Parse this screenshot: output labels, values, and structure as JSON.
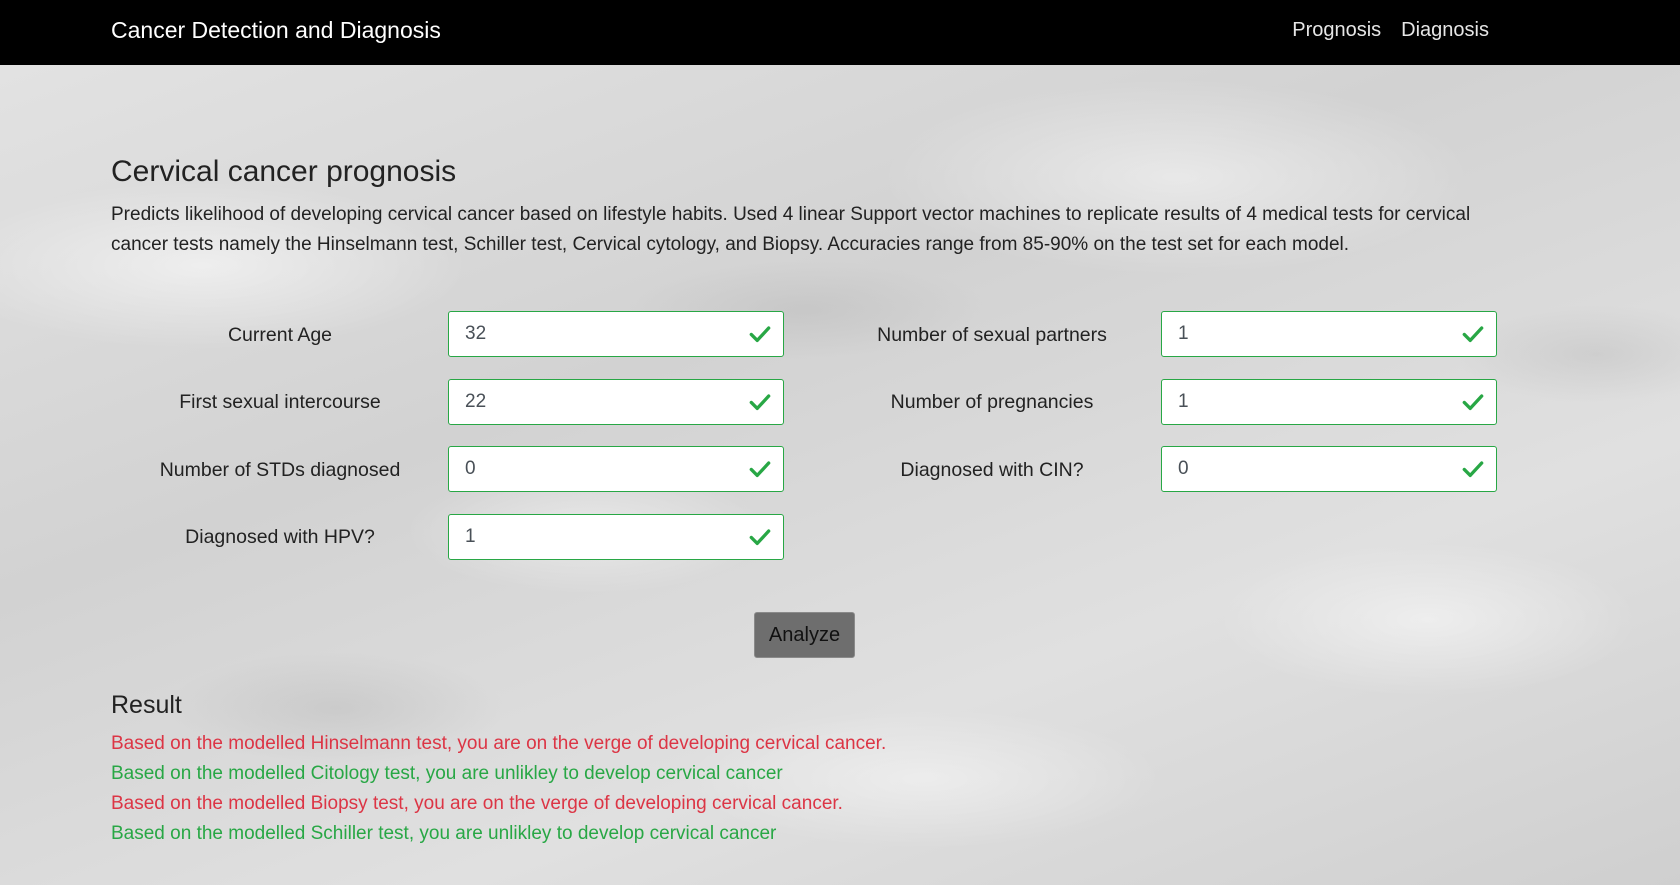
{
  "nav": {
    "brand": "Cancer Detection and Diagnosis",
    "links": [
      "Prognosis",
      "Diagnosis"
    ]
  },
  "main": {
    "title": "Cervical cancer prognosis",
    "description": "Predicts likelihood of developing cervical cancer based on lifestyle habits. Used 4 linear Support vector machines to replicate results of 4 medical tests for cervical cancer tests namely the Hinselmann test, Schiller test, Cervical cytology, and Biopsy. Accuracies range from 85-90% on the test set for each model."
  },
  "form": {
    "fields": [
      {
        "label": "Current Age",
        "value": "32"
      },
      {
        "label": "Number of sexual partners",
        "value": "1"
      },
      {
        "label": "First sexual intercourse",
        "value": "22"
      },
      {
        "label": "Number of pregnancies",
        "value": "1"
      },
      {
        "label": "Number of STDs diagnosed",
        "value": "0"
      },
      {
        "label": "Diagnosed with CIN?",
        "value": "0"
      },
      {
        "label": "Diagnosed with HPV?",
        "value": "1"
      }
    ],
    "valid_icon": "checkmark-icon",
    "analyze_label": "Analyze"
  },
  "result": {
    "title": "Result",
    "lines": [
      {
        "text": "Based on the modelled Hinselmann test, you are on the verge of developing cervical cancer.",
        "status": "danger"
      },
      {
        "text": "Based on the modelled Citology test, you are unlikley to develop cervical cancer",
        "status": "success"
      },
      {
        "text": "Based on the modelled Biopsy test, you are on the verge of developing cervical cancer.",
        "status": "danger"
      },
      {
        "text": "Based on the modelled Schiller test, you are unlikley to develop cervical cancer",
        "status": "success"
      }
    ]
  },
  "colors": {
    "navbar": "#000000",
    "valid": "#28a745",
    "danger": "#dc3545",
    "button": "#6e6e6e"
  }
}
